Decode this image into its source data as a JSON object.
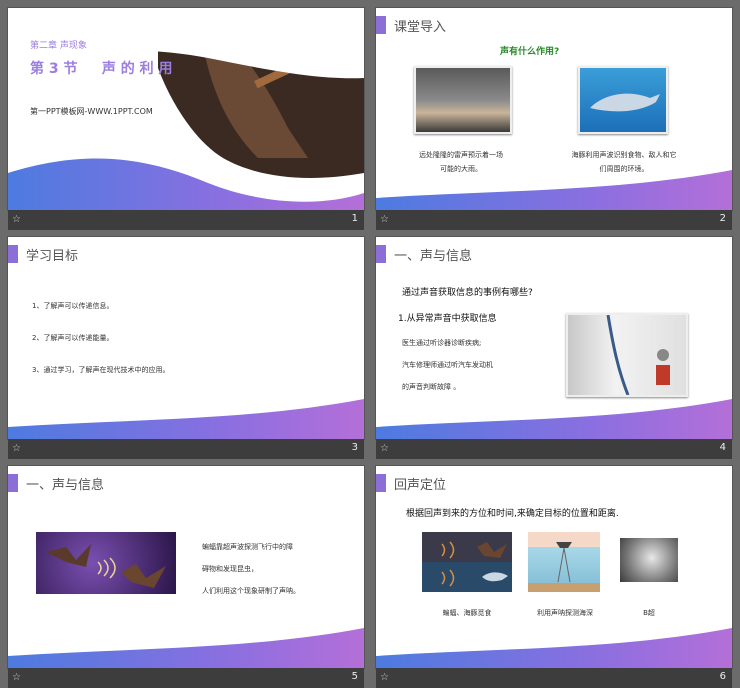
{
  "slides": [
    {
      "number": "1",
      "chapter": "第二章  声现象",
      "title": "第 3 节     声 的 利 用",
      "site": "第一PPT模板网-WWW.1PPT.COM"
    },
    {
      "number": "2",
      "header": "课堂导入",
      "question": "声有什么作用?",
      "caption_left": "远处隆隆的雷声预示着一场\n可能的大雨。",
      "caption_right": "海豚利用声波识别食物、敌人和它\n们周围的环境。"
    },
    {
      "number": "3",
      "header": "学习目标",
      "items": [
        "1、了解声可以传递信息。",
        "2、了解声可以传递能量。",
        "3、通过学习，了解声在现代技术中的应用。"
      ]
    },
    {
      "number": "4",
      "header": "一、声与信息",
      "question": "通过声音获取信息的事例有哪些?",
      "sub": "1.从异常声音中获取信息",
      "lines": [
        "医生通过听诊器诊断疾病;",
        "汽车修理师通过听汽车发动机",
        "的声音判断故障 。"
      ]
    },
    {
      "number": "5",
      "header": "一、声与信息",
      "lines": [
        "蝙蝠靠超声波探测飞行中的障",
        "碍物和发现昆虫，",
        "人们利用这个现象研制了声呐。"
      ]
    },
    {
      "number": "6",
      "header": "回声定位",
      "main": "根据回声到来的方位和时间,来确定目标的位置和距离.",
      "captions": [
        "蝙蝠、海豚觅食",
        "利用声呐探测海深",
        "B超"
      ]
    }
  ],
  "footer_icon": "star-icon",
  "colors": {
    "accent": "#8b6fd6",
    "blue": "#4a7fd8",
    "title_purple": "#9b7ee0"
  }
}
